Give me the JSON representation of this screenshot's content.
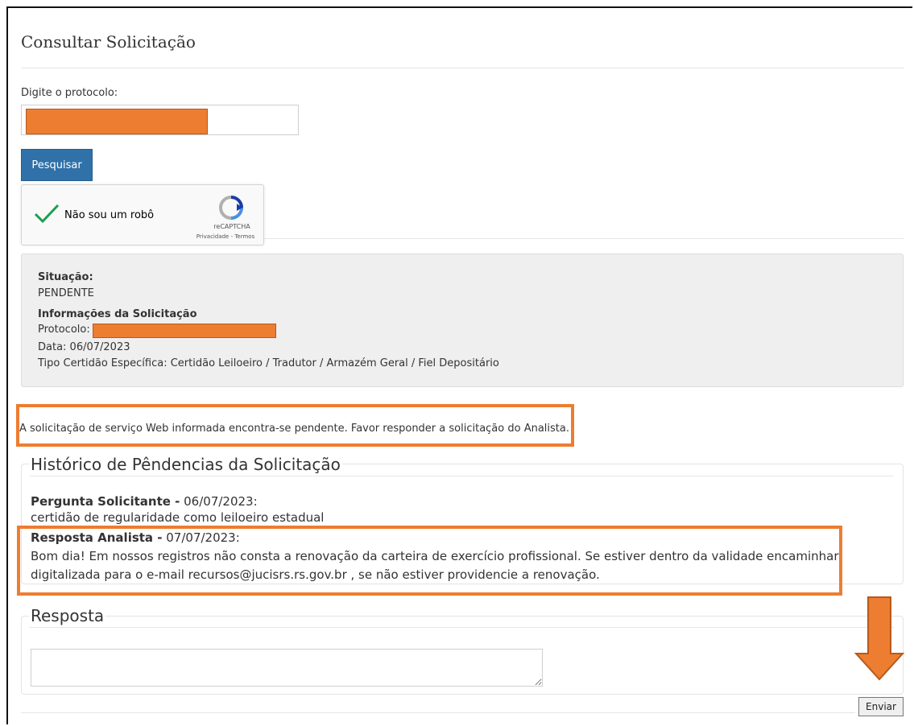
{
  "page": {
    "title": "Consultar Solicitação"
  },
  "search": {
    "label": "Digite o protocolo:",
    "value": "",
    "button_label": "Pesquisar"
  },
  "captcha": {
    "label": "Não sou um robô",
    "brand": "reCAPTCHA",
    "links": "Privacidade - Termos",
    "checked": true
  },
  "status": {
    "situacao_label": "Situação:",
    "situacao_value": "PENDENTE",
    "info_heading": "Informações da Solicitação",
    "protocolo_label": "Protocolo:",
    "data_line": "Data: 06/07/2023",
    "tipo_line": "Tipo Certidão Específica: Certidão Leiloeiro / Tradutor / Armazém Geral / Fiel Depositário"
  },
  "notice": "A solicitação de serviço Web informada encontra-se pendente. Favor responder a solicitação do Analista.",
  "history": {
    "legend": "Histórico de Pêndencias da Solicitação",
    "entries": [
      {
        "author": "Pergunta Solicitante -",
        "date": " 06/07/2023:",
        "lines": [
          "certidão de regularidade como leiloeiro estadual"
        ]
      },
      {
        "author": "Resposta Analista -",
        "date": " 07/07/2023:",
        "lines": [
          "Bom dia! Em nossos registros não consta a renovação da carteira de exercício profissional. Se estiver dentro da validade encaminhar",
          "digitalizada para o e-mail recursos@jucisrs.rs.gov.br , se não estiver providencie a renovação."
        ]
      }
    ]
  },
  "response": {
    "legend": "Resposta",
    "value": "",
    "send_label": "Enviar"
  },
  "colors": {
    "highlight": "#ed7d31",
    "primary_button": "#3071a9",
    "panel_bg": "#efefef"
  }
}
